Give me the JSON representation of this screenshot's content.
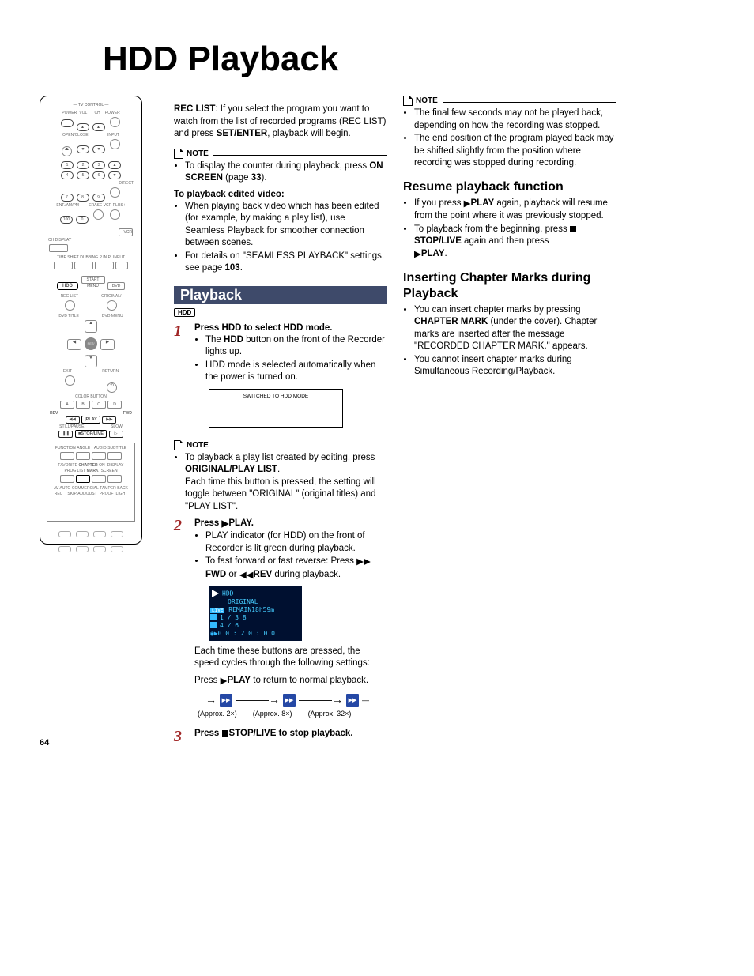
{
  "title": "HDD Playback",
  "page_number": "64",
  "remote": {
    "tv_control": "TV CONTROL",
    "power": "POWER",
    "vol": "VOL",
    "ch": "CH",
    "power2": "POWER",
    "openclose": "OPEN/CLOSE",
    "input": "INPUT",
    "direct": "DIRECT",
    "ent": "ENT./AM/PM",
    "erase": "ERASE",
    "vcrplus": "VCR PLUS+",
    "vcr": "VCR",
    "chdisplay": "CH DISPLAY",
    "timeshift": "TIME SHIFT",
    "dubbing": "DUBBING",
    "pinp": "P IN P",
    "hdd": "HDD",
    "startmenu": "START MENU",
    "dvd": "DVD",
    "reclist": "REC LIST",
    "original": "ORIGINAL/\nPLAY LIST",
    "dvdtitle": "DVD TITLE",
    "dvdmenu": "DVD MENU",
    "setenter": "SET/\nENTER",
    "exit": "EXIT",
    "return": "RETURN",
    "colorbutton": "COLOR BUTTON",
    "rev": "REV",
    "fwd": "FWD",
    "play": "|PLAY",
    "stillpause": "STILL/PAUSE",
    "slow": "SLOW",
    "stoplive": "■STOP/LIVE",
    "function": "FUNCTION",
    "angle": "ANGLE",
    "audio": "AUDIO",
    "subtitle": "SUBTITLE",
    "favprog": "FAVORITE\nPROG LIST",
    "chapter": "CHAPTER\nMARK",
    "onscreen": "ON\nSCREEN",
    "display": "DISPLAY",
    "avauto": "AV AUTO\nREC",
    "commskip": "COMMERCIAL\nSKIP/ADD/JUST",
    "temper": "TAMPER\nPROOF",
    "backlight": "BACK\nLIGHT"
  },
  "intro": {
    "rec_list_bold": "REC LIST",
    "rec_list_text": ": If you select the program you want to watch from the list of recorded programs (REC LIST) and press ",
    "setenter": "SET/ENTER",
    "rec_list_text2": ", playback will begin."
  },
  "note1": {
    "label": "NOTE",
    "b1a": "To display the counter during playback, press ",
    "b1b": "ON SCREEN",
    "b1c": " (page ",
    "b1d": "33",
    "b1e": ").",
    "edited": "To playback edited video:",
    "b2": "When playing back video which has been edited (for example, by making a play list), use Seamless Playback for smoother connection between scenes.",
    "b3a": "For details on \"SEAMLESS PLAYBACK\" settings, see page ",
    "b3b": "103",
    "b3c": "."
  },
  "playback_header": "Playback",
  "hdd_badge": "HDD",
  "step1": {
    "head_a": "Press ",
    "head_b": "HDD",
    "head_c": " to select HDD mode.",
    "b1a": "The ",
    "b1b": "HDD",
    "b1c": " button on the front of the Recorder lights up.",
    "b2": "HDD mode is selected automatically when the power is turned on.",
    "switched": "SWITCHED TO HDD MODE"
  },
  "note2": {
    "label": "NOTE",
    "t1a": "To playback a play list created by editing, press ",
    "t1b": "ORIGINAL/PLAY LIST",
    "t1c": ".",
    "t2": "Each time this button is pressed, the setting will toggle between \"ORIGINAL\" (original titles) and \"PLAY LIST\"."
  },
  "step2": {
    "head_a": "Press ",
    "head_b": "|PLAY",
    "head_c": ".",
    "b1": "PLAY indicator (for HDD) on the front of Recorder is lit green during playback.",
    "b2a": "To fast forward or fast reverse: Press ",
    "b2b": "FWD",
    "b2c": " or ",
    "b2d": "REV",
    "b2e": " during playback.",
    "osd": {
      "l1": "HDD",
      "l2": "ORIGINAL",
      "l3": "REMAIN18h59m",
      "l4": "1 / 3 8",
      "l5": "4 / 6",
      "l6": "0 0 : 2 0 : 0 0"
    },
    "each": "Each time these buttons are pressed, the speed cycles through the following settings:",
    "press_a": "Press ",
    "press_b": "|PLAY",
    "press_c": " to return to normal playback.",
    "speeds": {
      "s1": "(Approx. 2×)",
      "s2": "(Approx. 8×)",
      "s3": "(Approx. 32×)"
    }
  },
  "step3": {
    "head_a": "Press ",
    "head_b": "■STOP/LIVE",
    "head_c": " to stop playback."
  },
  "note3": {
    "label": "NOTE",
    "b1": "The final few seconds may not be played back, depending on how the recording was stopped.",
    "b2": "The end position of the program played back may be shifted slightly from the position where recording was stopped during recording."
  },
  "resume": {
    "title": "Resume playback function",
    "b1a": "If you press ",
    "b1b": "|PLAY",
    "b1c": " again, playback will resume from the point where it was previously stopped.",
    "b2a": "To playback from the beginning, press ",
    "b2b": "■STOP/LIVE",
    "b2c": " again and then press ",
    "b2d": "|PLAY",
    "b2e": "."
  },
  "chapter": {
    "title": "Inserting Chapter Marks during Playback",
    "b1a": "You can insert chapter marks by pressing ",
    "b1b": "CHAPTER MARK",
    "b1c": " (under the cover). Chapter marks are inserted after the message \"RECORDED CHAPTER MARK.\" appears.",
    "b2": "You cannot insert chapter marks during Simultaneous Recording/Playback."
  }
}
